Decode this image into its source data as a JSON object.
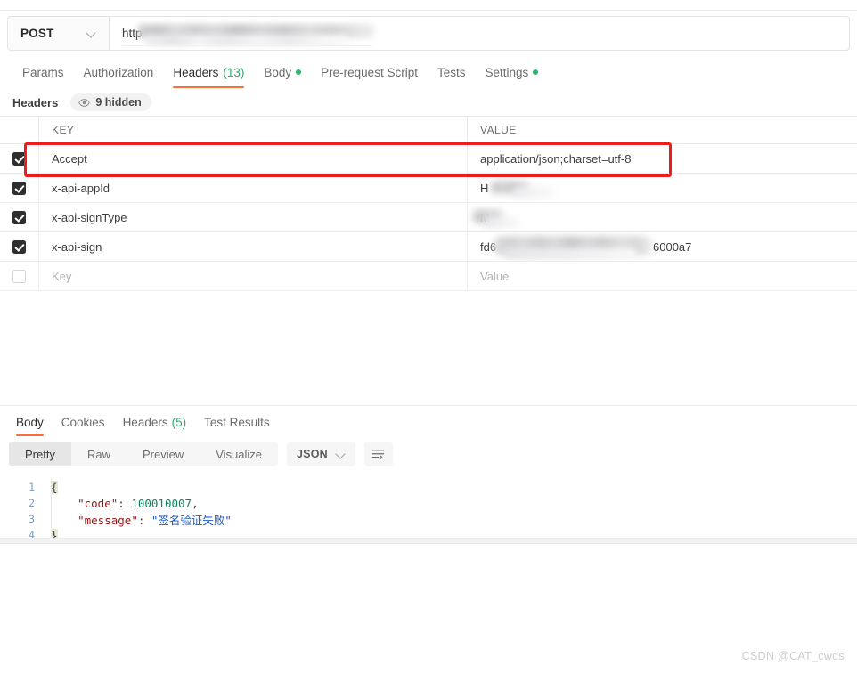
{
  "request": {
    "method": "POST",
    "url_text": "http",
    "url_redacted": true,
    "tabs": [
      {
        "label": "Params",
        "active": false,
        "badge": "",
        "dot": false
      },
      {
        "label": "Authorization",
        "active": false,
        "badge": "",
        "dot": false
      },
      {
        "label": "Headers",
        "active": true,
        "badge": "(13)",
        "dot": false
      },
      {
        "label": "Body",
        "active": false,
        "badge": "",
        "dot": true
      },
      {
        "label": "Pre-request Script",
        "active": false,
        "badge": "",
        "dot": false
      },
      {
        "label": "Tests",
        "active": false,
        "badge": "",
        "dot": false
      },
      {
        "label": "Settings",
        "active": false,
        "badge": "",
        "dot": true
      }
    ]
  },
  "headers_section": {
    "title": "Headers",
    "hidden_badge": "9 hidden",
    "columns": {
      "key": "KEY",
      "value": "VALUE"
    },
    "rows": [
      {
        "checked": true,
        "key": "Accept",
        "value": "application/json;charset=utf-8",
        "highlighted": true,
        "redacted": "none"
      },
      {
        "checked": true,
        "key": "x-api-appId",
        "value": "H",
        "highlighted": false,
        "redacted": "appid"
      },
      {
        "checked": true,
        "key": "x-api-signType",
        "value": "M",
        "highlighted": false,
        "redacted": "signtype"
      },
      {
        "checked": true,
        "key": "x-api-sign",
        "value": "fd6",
        "highlighted": false,
        "redacted": "sign",
        "value_tail": "6000a7"
      },
      {
        "checked": false,
        "key": "Key",
        "value": "Value",
        "highlighted": false,
        "redacted": "none",
        "placeholder": true
      }
    ]
  },
  "response": {
    "tabs": [
      {
        "label": "Body",
        "active": true,
        "badge": ""
      },
      {
        "label": "Cookies",
        "active": false,
        "badge": ""
      },
      {
        "label": "Headers",
        "active": false,
        "badge": "(5)"
      },
      {
        "label": "Test Results",
        "active": false,
        "badge": ""
      }
    ],
    "view_modes": [
      {
        "label": "Pretty",
        "active": true
      },
      {
        "label": "Raw",
        "active": false
      },
      {
        "label": "Preview",
        "active": false
      },
      {
        "label": "Visualize",
        "active": false
      }
    ],
    "format": "JSON",
    "body_lines": [
      {
        "num": "1",
        "segments": [
          {
            "text": "{",
            "cls": "punct brace-hl"
          }
        ]
      },
      {
        "num": "2",
        "segments": [
          {
            "text": "    ",
            "cls": "punct"
          },
          {
            "text": "\"code\"",
            "cls": "k-str"
          },
          {
            "text": ": ",
            "cls": "punct"
          },
          {
            "text": "100010007",
            "cls": "k-num"
          },
          {
            "text": ",",
            "cls": "punct"
          }
        ]
      },
      {
        "num": "3",
        "segments": [
          {
            "text": "    ",
            "cls": "punct"
          },
          {
            "text": "\"message\"",
            "cls": "k-str"
          },
          {
            "text": ": ",
            "cls": "punct"
          },
          {
            "text": "\"签名验证失败\"",
            "cls": "v-str"
          }
        ]
      },
      {
        "num": "4",
        "segments": [
          {
            "text": "}",
            "cls": "punct brace-hl"
          }
        ]
      }
    ]
  },
  "watermark": "CSDN @CAT_cwds",
  "colors": {
    "accent_orange": "#ff6c37",
    "count_green": "#3aa76d",
    "status_dot_green": "#25b869",
    "annotation_red": "#ee1d1d",
    "json_key": "#a31515",
    "json_number": "#098658",
    "json_string": "#1a56c4"
  }
}
